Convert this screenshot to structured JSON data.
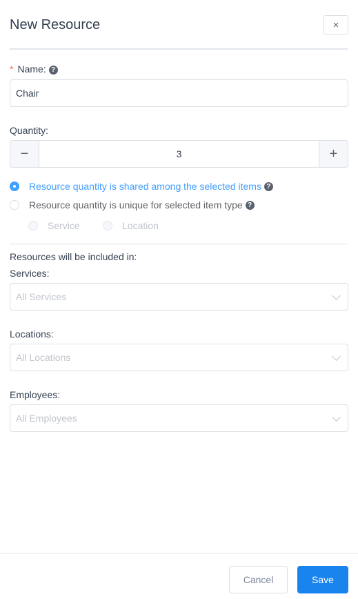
{
  "dialog": {
    "title": "New Resource",
    "close_icon": "×"
  },
  "name_field": {
    "required_mark": "*",
    "label": "Name:",
    "help_icon": "?",
    "value": "Chair"
  },
  "quantity": {
    "label": "Quantity:",
    "minus_icon": "−",
    "plus_icon": "+",
    "value": "3"
  },
  "quantity_mode": {
    "options": [
      {
        "label": "Resource quantity is shared among the selected items",
        "checked": true
      },
      {
        "label": "Resource quantity is unique for selected item type",
        "checked": false
      }
    ],
    "sub_options": [
      {
        "label": "Service",
        "disabled": true
      },
      {
        "label": "Location",
        "disabled": true
      }
    ]
  },
  "inclusion": {
    "heading": "Resources will be included in:",
    "services": {
      "label": "Services:",
      "placeholder": "All Services"
    },
    "locations": {
      "label": "Locations:",
      "placeholder": "All Locations"
    },
    "employees": {
      "label": "Employees:",
      "placeholder": "All Employees"
    }
  },
  "footer": {
    "cancel_label": "Cancel",
    "save_label": "Save"
  },
  "colors": {
    "accent": "#409eff",
    "primary_button": "#1a84ee",
    "required": "#f56c6c"
  }
}
